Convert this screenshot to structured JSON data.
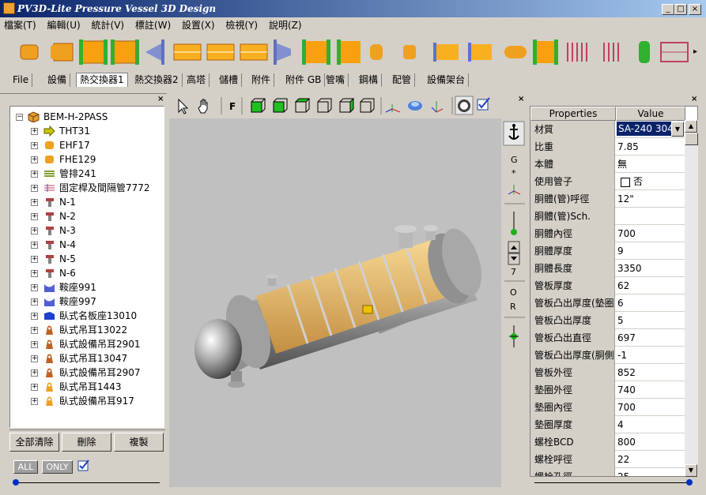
{
  "window": {
    "title": "PV3D-Lite Pressure Vessel 3D Design",
    "min": "_",
    "max": "□",
    "close": "×"
  },
  "menu": [
    "檔案(T)",
    "編輯(U)",
    "統計(V)",
    "標註(W)",
    "設置(X)",
    "檢視(Y)",
    "說明(Z)"
  ],
  "tabs": [
    "File",
    "設備",
    "熱交換器1",
    "熱交換器2",
    "高塔",
    "儲槽",
    "附件",
    "附件 GB",
    "管嘴",
    "鋼構",
    "配管",
    "設備架台"
  ],
  "active_tab": "熱交換器1",
  "toolbar": {
    "more": "▸"
  },
  "tree": {
    "root": "BEM-H-2PASS",
    "items": [
      {
        "label": "THT31",
        "icon": "arrow-icon",
        "color": "#c8c800"
      },
      {
        "label": "EHF17",
        "icon": "ellipsoidal-head-icon",
        "color": "#f0a020"
      },
      {
        "label": "FHE129",
        "icon": "flat-head-icon",
        "color": "#f0a020"
      },
      {
        "label": "管排241",
        "icon": "tube-bundle-icon",
        "color": "#80a030"
      },
      {
        "label": "固定桿及間隔管7772",
        "icon": "tie-rod-icon",
        "color": "#c04060"
      },
      {
        "label": "N-1",
        "icon": "nozzle-icon",
        "color": "#b04040"
      },
      {
        "label": "N-2",
        "icon": "nozzle-icon",
        "color": "#b04040"
      },
      {
        "label": "N-3",
        "icon": "nozzle-icon",
        "color": "#b04040"
      },
      {
        "label": "N-4",
        "icon": "nozzle-icon",
        "color": "#b04040"
      },
      {
        "label": "N-5",
        "icon": "nozzle-icon",
        "color": "#b04040"
      },
      {
        "label": "N-6",
        "icon": "nozzle-icon",
        "color": "#b04040"
      },
      {
        "label": "鞍座991",
        "icon": "saddle-icon",
        "color": "#5060d0"
      },
      {
        "label": "鞍座997",
        "icon": "saddle-icon",
        "color": "#5060d0"
      },
      {
        "label": "臥式名板座13010",
        "icon": "nameplate-icon",
        "color": "#2040d0"
      },
      {
        "label": "臥式吊耳13022",
        "icon": "lifting-lug-icon",
        "color": "#c06020"
      },
      {
        "label": "臥式設備吊耳2901",
        "icon": "lifting-lug-icon",
        "color": "#c06020"
      },
      {
        "label": "臥式吊耳13047",
        "icon": "lifting-lug-icon",
        "color": "#c06020"
      },
      {
        "label": "臥式設備吊耳2907",
        "icon": "lifting-lug-icon",
        "color": "#c06020"
      },
      {
        "label": "臥式吊耳1443",
        "icon": "lifting-lug-icon",
        "color": "#f0a020"
      },
      {
        "label": "臥式設備吊耳917",
        "icon": "lifting-lug-icon",
        "color": "#f0a020"
      }
    ]
  },
  "buttons": {
    "clear_all": "全部清除",
    "delete": "刪除",
    "copy": "複製",
    "all": "ALL",
    "only": "ONLY"
  },
  "viewer": {
    "f_label": "F"
  },
  "sidebar": {
    "g": "G",
    "star": "*",
    "seven": "7",
    "o": "O",
    "r": "R"
  },
  "props": {
    "header_name": "Properties",
    "header_value": "Value",
    "rows": [
      {
        "name": "材質",
        "value": "SA-240 304"
      },
      {
        "name": "比重",
        "value": "7.85"
      },
      {
        "name": "本體",
        "value": "無"
      },
      {
        "name": "使用管子",
        "value": "否"
      },
      {
        "name": "胴體(管)呼徑",
        "value": "12\""
      },
      {
        "name": "胴體(管)Sch.",
        "value": ""
      },
      {
        "name": "胴體內徑",
        "value": "700"
      },
      {
        "name": "胴體厚度",
        "value": "9"
      },
      {
        "name": "胴體長度",
        "value": "3350"
      },
      {
        "name": "管板厚度",
        "value": "62"
      },
      {
        "name": "管板凸出厚度(墊圈",
        "value": "6"
      },
      {
        "name": "管板凸出厚度",
        "value": "5"
      },
      {
        "name": "管板凸出直徑",
        "value": "697"
      },
      {
        "name": "管板凸出厚度(胴側",
        "value": "-1"
      },
      {
        "name": "管板外徑",
        "value": "852"
      },
      {
        "name": "墊圈外徑",
        "value": "740"
      },
      {
        "name": "墊圈內徑",
        "value": "700"
      },
      {
        "name": "墊圈厚度",
        "value": "4"
      },
      {
        "name": "螺栓BCD",
        "value": "800"
      },
      {
        "name": "螺栓呼徑",
        "value": "22"
      },
      {
        "name": "螺栓孔徑",
        "value": "25"
      }
    ]
  },
  "colors": {
    "accent": "#0a246a",
    "orange": "#f0a020",
    "green": "#20b020",
    "pipe_blue": "#6070d0"
  }
}
